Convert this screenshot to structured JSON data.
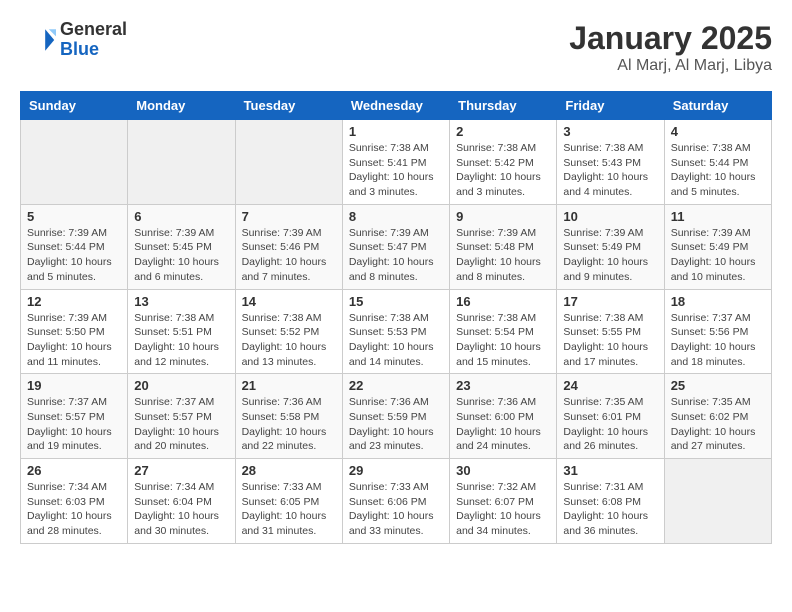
{
  "header": {
    "logo_general": "General",
    "logo_blue": "Blue",
    "title": "January 2025",
    "subtitle": "Al Marj, Al Marj, Libya"
  },
  "days_of_week": [
    "Sunday",
    "Monday",
    "Tuesday",
    "Wednesday",
    "Thursday",
    "Friday",
    "Saturday"
  ],
  "weeks": [
    [
      {
        "day": "",
        "info": ""
      },
      {
        "day": "",
        "info": ""
      },
      {
        "day": "",
        "info": ""
      },
      {
        "day": "1",
        "info": "Sunrise: 7:38 AM\nSunset: 5:41 PM\nDaylight: 10 hours\nand 3 minutes."
      },
      {
        "day": "2",
        "info": "Sunrise: 7:38 AM\nSunset: 5:42 PM\nDaylight: 10 hours\nand 3 minutes."
      },
      {
        "day": "3",
        "info": "Sunrise: 7:38 AM\nSunset: 5:43 PM\nDaylight: 10 hours\nand 4 minutes."
      },
      {
        "day": "4",
        "info": "Sunrise: 7:38 AM\nSunset: 5:44 PM\nDaylight: 10 hours\nand 5 minutes."
      }
    ],
    [
      {
        "day": "5",
        "info": "Sunrise: 7:39 AM\nSunset: 5:44 PM\nDaylight: 10 hours\nand 5 minutes."
      },
      {
        "day": "6",
        "info": "Sunrise: 7:39 AM\nSunset: 5:45 PM\nDaylight: 10 hours\nand 6 minutes."
      },
      {
        "day": "7",
        "info": "Sunrise: 7:39 AM\nSunset: 5:46 PM\nDaylight: 10 hours\nand 7 minutes."
      },
      {
        "day": "8",
        "info": "Sunrise: 7:39 AM\nSunset: 5:47 PM\nDaylight: 10 hours\nand 8 minutes."
      },
      {
        "day": "9",
        "info": "Sunrise: 7:39 AM\nSunset: 5:48 PM\nDaylight: 10 hours\nand 8 minutes."
      },
      {
        "day": "10",
        "info": "Sunrise: 7:39 AM\nSunset: 5:49 PM\nDaylight: 10 hours\nand 9 minutes."
      },
      {
        "day": "11",
        "info": "Sunrise: 7:39 AM\nSunset: 5:49 PM\nDaylight: 10 hours\nand 10 minutes."
      }
    ],
    [
      {
        "day": "12",
        "info": "Sunrise: 7:39 AM\nSunset: 5:50 PM\nDaylight: 10 hours\nand 11 minutes."
      },
      {
        "day": "13",
        "info": "Sunrise: 7:38 AM\nSunset: 5:51 PM\nDaylight: 10 hours\nand 12 minutes."
      },
      {
        "day": "14",
        "info": "Sunrise: 7:38 AM\nSunset: 5:52 PM\nDaylight: 10 hours\nand 13 minutes."
      },
      {
        "day": "15",
        "info": "Sunrise: 7:38 AM\nSunset: 5:53 PM\nDaylight: 10 hours\nand 14 minutes."
      },
      {
        "day": "16",
        "info": "Sunrise: 7:38 AM\nSunset: 5:54 PM\nDaylight: 10 hours\nand 15 minutes."
      },
      {
        "day": "17",
        "info": "Sunrise: 7:38 AM\nSunset: 5:55 PM\nDaylight: 10 hours\nand 17 minutes."
      },
      {
        "day": "18",
        "info": "Sunrise: 7:37 AM\nSunset: 5:56 PM\nDaylight: 10 hours\nand 18 minutes."
      }
    ],
    [
      {
        "day": "19",
        "info": "Sunrise: 7:37 AM\nSunset: 5:57 PM\nDaylight: 10 hours\nand 19 minutes."
      },
      {
        "day": "20",
        "info": "Sunrise: 7:37 AM\nSunset: 5:57 PM\nDaylight: 10 hours\nand 20 minutes."
      },
      {
        "day": "21",
        "info": "Sunrise: 7:36 AM\nSunset: 5:58 PM\nDaylight: 10 hours\nand 22 minutes."
      },
      {
        "day": "22",
        "info": "Sunrise: 7:36 AM\nSunset: 5:59 PM\nDaylight: 10 hours\nand 23 minutes."
      },
      {
        "day": "23",
        "info": "Sunrise: 7:36 AM\nSunset: 6:00 PM\nDaylight: 10 hours\nand 24 minutes."
      },
      {
        "day": "24",
        "info": "Sunrise: 7:35 AM\nSunset: 6:01 PM\nDaylight: 10 hours\nand 26 minutes."
      },
      {
        "day": "25",
        "info": "Sunrise: 7:35 AM\nSunset: 6:02 PM\nDaylight: 10 hours\nand 27 minutes."
      }
    ],
    [
      {
        "day": "26",
        "info": "Sunrise: 7:34 AM\nSunset: 6:03 PM\nDaylight: 10 hours\nand 28 minutes."
      },
      {
        "day": "27",
        "info": "Sunrise: 7:34 AM\nSunset: 6:04 PM\nDaylight: 10 hours\nand 30 minutes."
      },
      {
        "day": "28",
        "info": "Sunrise: 7:33 AM\nSunset: 6:05 PM\nDaylight: 10 hours\nand 31 minutes."
      },
      {
        "day": "29",
        "info": "Sunrise: 7:33 AM\nSunset: 6:06 PM\nDaylight: 10 hours\nand 33 minutes."
      },
      {
        "day": "30",
        "info": "Sunrise: 7:32 AM\nSunset: 6:07 PM\nDaylight: 10 hours\nand 34 minutes."
      },
      {
        "day": "31",
        "info": "Sunrise: 7:31 AM\nSunset: 6:08 PM\nDaylight: 10 hours\nand 36 minutes."
      },
      {
        "day": "",
        "info": ""
      }
    ]
  ]
}
